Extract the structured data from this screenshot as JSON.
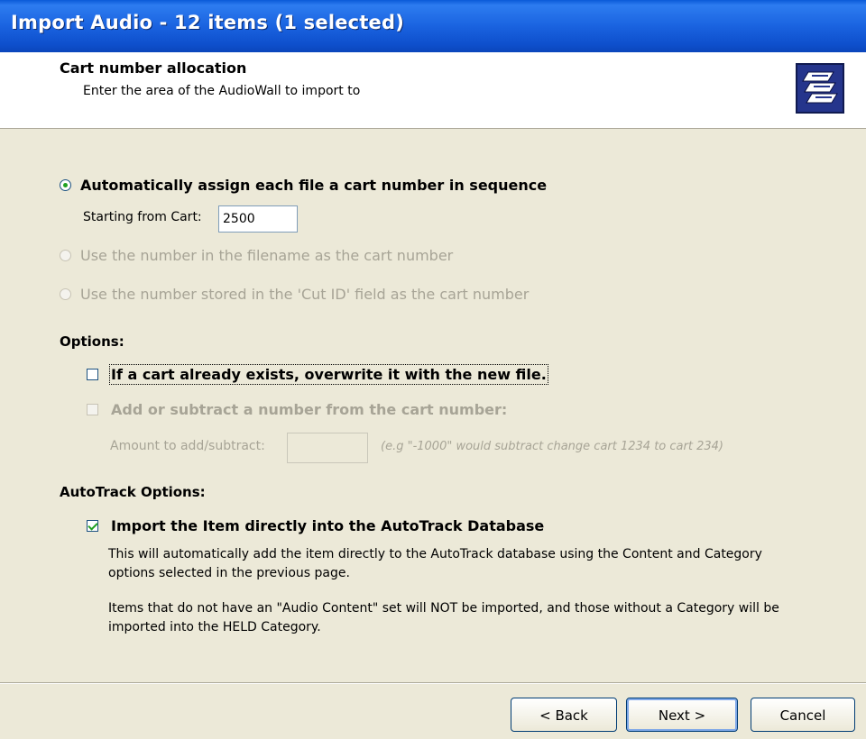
{
  "window": {
    "title": "Import Audio - 12 items (1 selected)"
  },
  "header": {
    "title": "Cart number allocation",
    "subtitle": "Enter the area of the AudioWall to import to",
    "icon": "wizard-document-icon"
  },
  "allocation": {
    "auto_label": "Automatically assign each file a cart number in sequence",
    "start_label": "Starting from Cart:",
    "start_value": "2500",
    "filename_label": "Use the number in the filename as the cart number",
    "cutid_label": "Use the number stored in the 'Cut ID' field as the cart number",
    "selected": "auto"
  },
  "options": {
    "heading": "Options:",
    "overwrite_label": "If a cart already exists, overwrite it with the new file.",
    "overwrite_checked": false,
    "offset_label": "Add or subtract a number from the cart number:",
    "offset_checked": false,
    "amount_label": "Amount to add/subtract:",
    "amount_value": "",
    "amount_hint": "(e.g \"-1000\" would subtract change cart 1234 to cart 234)"
  },
  "autotrack": {
    "heading": "AutoTrack Options:",
    "import_label": "Import the Item directly into the AutoTrack Database",
    "import_checked": true,
    "desc1": "This will automatically add the item directly to the AutoTrack database using the Content and Category options selected in the previous page.",
    "desc2": "Items that do not have an \"Audio Content\" set will NOT be imported, and those without a Category will be imported into the HELD Category."
  },
  "buttons": {
    "back": "< Back",
    "next": "Next >",
    "cancel": "Cancel"
  },
  "colors": {
    "titlebar": "#0e4fcc",
    "dialog_bg": "#ece9d8",
    "check_mark": "#21a121",
    "disabled_text": "#a7a496"
  }
}
